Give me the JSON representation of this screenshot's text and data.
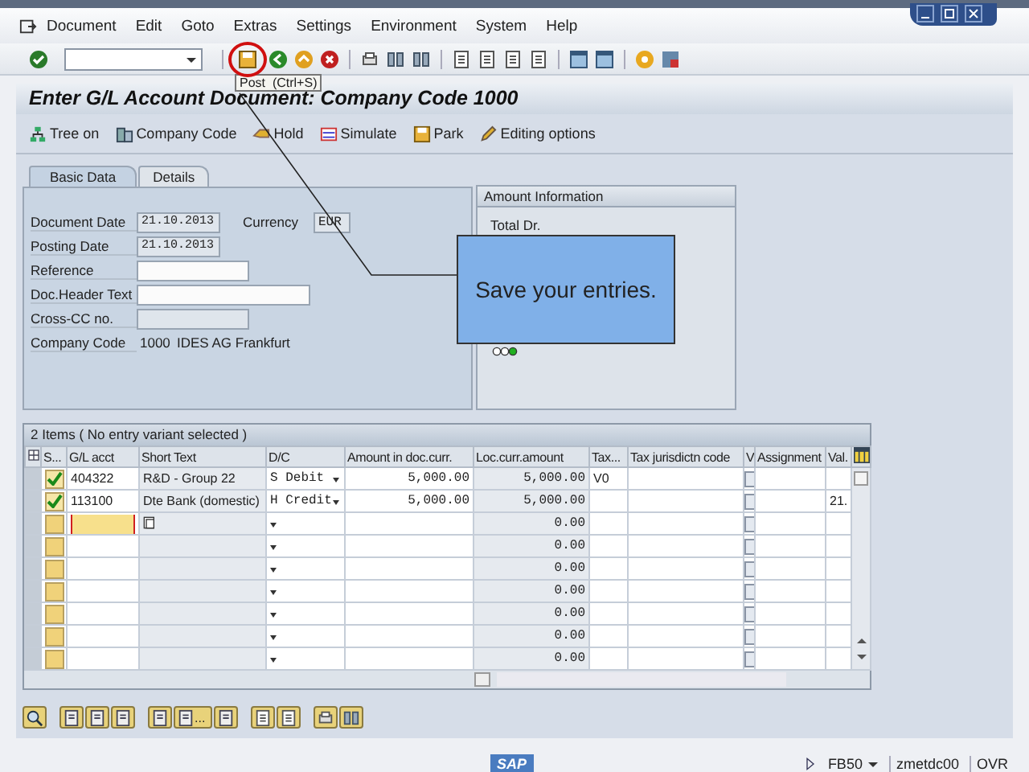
{
  "menu": [
    "Document",
    "Edit",
    "Goto",
    "Extras",
    "Settings",
    "Environment",
    "System",
    "Help"
  ],
  "tooltip": "Post  (Ctrl+S)",
  "title": "Enter G/L Account Document: Company Code 1000",
  "app_toolbar": [
    {
      "kind": "tree",
      "label": "Tree on"
    },
    {
      "kind": "company",
      "label": "Company Code"
    },
    {
      "kind": "hold",
      "label": "Hold"
    },
    {
      "kind": "simulate",
      "label": "Simulate"
    },
    {
      "kind": "park",
      "label": "Park"
    },
    {
      "kind": "edit",
      "label": "Editing options"
    }
  ],
  "tabs": [
    {
      "label": "Basic Data",
      "selected": true
    },
    {
      "label": "Details",
      "selected": false
    }
  ],
  "header_fields": [
    {
      "label": "Document Date",
      "kind": "date",
      "value": "21.10.2013",
      "extra_label": "Currency",
      "extra_value": "EUR"
    },
    {
      "label": "Posting Date",
      "kind": "date",
      "value": "21.10.2013"
    },
    {
      "label": "Reference",
      "kind": "text",
      "disabled": false
    },
    {
      "label": "Doc.Header Text",
      "kind": "long",
      "disabled": false
    },
    {
      "label": "Cross-CC no.",
      "kind": "text",
      "disabled": true
    },
    {
      "label": "Company Code",
      "kind": "display",
      "value": "1000",
      "description": "IDES AG Frankfurt"
    }
  ],
  "amount_info": {
    "title": "Amount Information",
    "total_label": "Total Dr.",
    "lights": [
      {
        "color": "#ffffff"
      },
      {
        "color": "#ffffff"
      },
      {
        "color": "#20b020"
      }
    ]
  },
  "callout": "Save your entries.",
  "table": {
    "title": "2 Items ( No entry variant selected )",
    "columns": [
      "S...",
      "G/L acct",
      "Short Text",
      "D/C",
      "Amount in doc.curr.",
      "Loc.curr.amount",
      "Tax...",
      "Tax jurisdictn code",
      "V",
      "Assignment",
      "Val."
    ],
    "rows": [
      {
        "checked": true,
        "gl_acct": "404322",
        "short_text": "R&D - Group 22",
        "dc": "S Debit",
        "amount": "5,000.00",
        "loc_amount": "5,000.00",
        "tax": "V0",
        "v_checked": false
      },
      {
        "checked": true,
        "gl_acct": "113100",
        "short_text": "Dte Bank (domestic)",
        "dc": "H Credit",
        "amount": "5,000.00",
        "loc_amount": "5,000.00",
        "v_checked": false,
        "val": "21."
      },
      {
        "checked": false,
        "focused": true,
        "loc_amount": "0.00",
        "v_checked": false
      },
      {
        "checked": false,
        "loc_amount": "0.00",
        "v_checked": false
      },
      {
        "checked": false,
        "loc_amount": "0.00",
        "v_checked": false
      },
      {
        "checked": false,
        "loc_amount": "0.00",
        "v_checked": false
      },
      {
        "checked": false,
        "loc_amount": "0.00",
        "v_checked": false
      },
      {
        "checked": false,
        "loc_amount": "0.00",
        "v_checked": false
      },
      {
        "checked": false,
        "loc_amount": "0.00",
        "v_checked": false
      }
    ]
  },
  "bottom_more": "...",
  "status_bar": {
    "logo": "SAP",
    "transaction": "FB50",
    "user": "zmetdc00",
    "mode": "OVR"
  }
}
